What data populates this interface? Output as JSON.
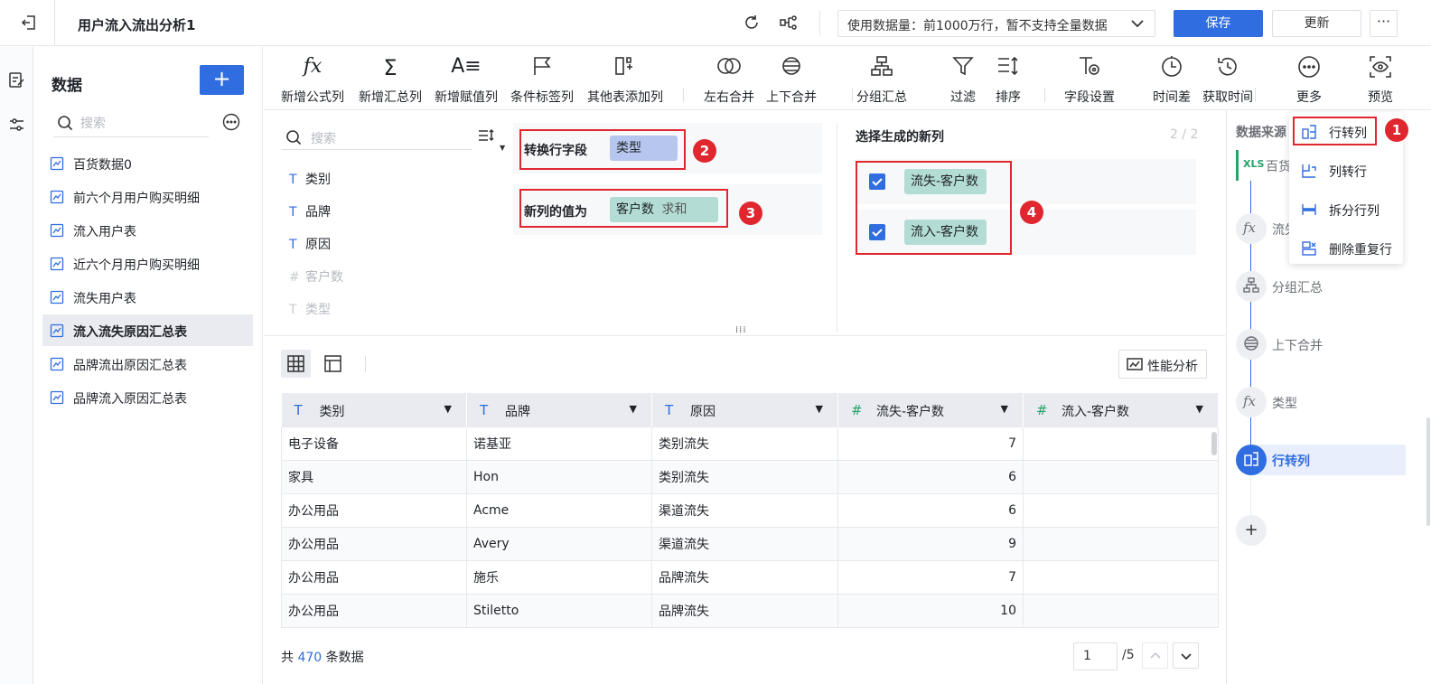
{
  "header": {
    "title": "用户流入流出分析1",
    "data_size": "使用数据量：前1000万行，暂不支持全量数据",
    "save": "保存",
    "update": "更新",
    "more": "···"
  },
  "data_panel": {
    "title": "数据",
    "add": "+",
    "search_placeholder": "搜索",
    "items": [
      {
        "label": "百货数据0"
      },
      {
        "label": "前六个月用户购买明细"
      },
      {
        "label": "流入用户表"
      },
      {
        "label": "近六个月用户购买明细"
      },
      {
        "label": "流失用户表"
      },
      {
        "label": "流入流失原因汇总表"
      },
      {
        "label": "品牌流出原因汇总表"
      },
      {
        "label": "品牌流入原因汇总表"
      }
    ],
    "active_index": 5
  },
  "toolbar": {
    "items": [
      "新增公式列",
      "新增汇总列",
      "新增赋值列",
      "条件标签列",
      "其他表添加列",
      "左右合并",
      "上下合并",
      "分组汇总",
      "过滤",
      "排序",
      "字段设置",
      "时间差",
      "获取时间",
      "更多",
      "预览"
    ]
  },
  "config": {
    "search_placeholder": "搜索",
    "fields": [
      {
        "label": "类别",
        "enabled": true
      },
      {
        "label": "品牌",
        "enabled": true
      },
      {
        "label": "原因",
        "enabled": true
      },
      {
        "label": "客户数",
        "enabled": false
      },
      {
        "label": "类型",
        "enabled": false
      }
    ],
    "row_field_label": "转换行字段",
    "row_field_value": "类型",
    "value_label": "新列的值为",
    "value_field": "客户数",
    "value_agg": "求和",
    "newcol_title": "选择生成的新列",
    "newcol_count": "2 / 2",
    "newcols": [
      "流失-客户数",
      "流入-客户数"
    ],
    "badges": [
      "1",
      "2",
      "3",
      "4"
    ]
  },
  "table": {
    "perf": "性能分析",
    "columns": [
      {
        "label": "类别",
        "type": "text"
      },
      {
        "label": "品牌",
        "type": "text"
      },
      {
        "label": "原因",
        "type": "text"
      },
      {
        "label": "流失-客户数",
        "type": "number"
      },
      {
        "label": "流入-客户数",
        "type": "number"
      }
    ],
    "rows": [
      [
        "电子设备",
        "诺基亚",
        "类别流失",
        "7",
        ""
      ],
      [
        "家具",
        "Hon",
        "类别流失",
        "6",
        ""
      ],
      [
        "办公用品",
        "Acme",
        "渠道流失",
        "6",
        ""
      ],
      [
        "办公用品",
        "Avery",
        "渠道流失",
        "9",
        ""
      ],
      [
        "办公用品",
        "施乐",
        "品牌流失",
        "7",
        ""
      ],
      [
        "办公用品",
        "Stiletto",
        "品牌流失",
        "10",
        ""
      ]
    ],
    "total_prefix": "共",
    "total_count": "470",
    "total_suffix": "条数据",
    "page": "1",
    "page_total": "/5"
  },
  "right_panel": {
    "source_title": "数据来源",
    "source_name": "百货",
    "steps": [
      {
        "label": "流失"
      },
      {
        "label": "分组汇总"
      },
      {
        "label": "上下合并"
      },
      {
        "label": "类型"
      },
      {
        "label": "行转列"
      }
    ],
    "add": "+"
  },
  "dropdown": {
    "items": [
      "行转列",
      "列转行",
      "拆分行列",
      "删除重复行"
    ]
  }
}
